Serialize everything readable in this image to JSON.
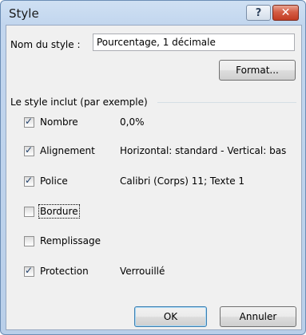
{
  "window": {
    "title": "Style",
    "help_label": "?",
    "close_label": "✕"
  },
  "style_name": {
    "label": "Nom du style :",
    "value": "Pourcentage, 1 décimale"
  },
  "format_button": {
    "label": "Format..."
  },
  "group": {
    "title": "Le style inclut (par exemple)",
    "items": [
      {
        "label": "Nombre",
        "checked": true,
        "value": "0,0%"
      },
      {
        "label": "Alignement",
        "checked": true,
        "value": "Horizontal: standard - Vertical: bas"
      },
      {
        "label": "Police",
        "checked": true,
        "value": "Calibri (Corps) 11; Texte 1"
      },
      {
        "label": "Bordure",
        "checked": false,
        "value": ""
      },
      {
        "label": "Remplissage",
        "checked": false,
        "value": ""
      },
      {
        "label": "Protection",
        "checked": true,
        "value": "Verrouillé"
      }
    ]
  },
  "buttons": {
    "ok": "OK",
    "cancel": "Annuler"
  },
  "icons": {
    "check_glyph": "✓"
  }
}
